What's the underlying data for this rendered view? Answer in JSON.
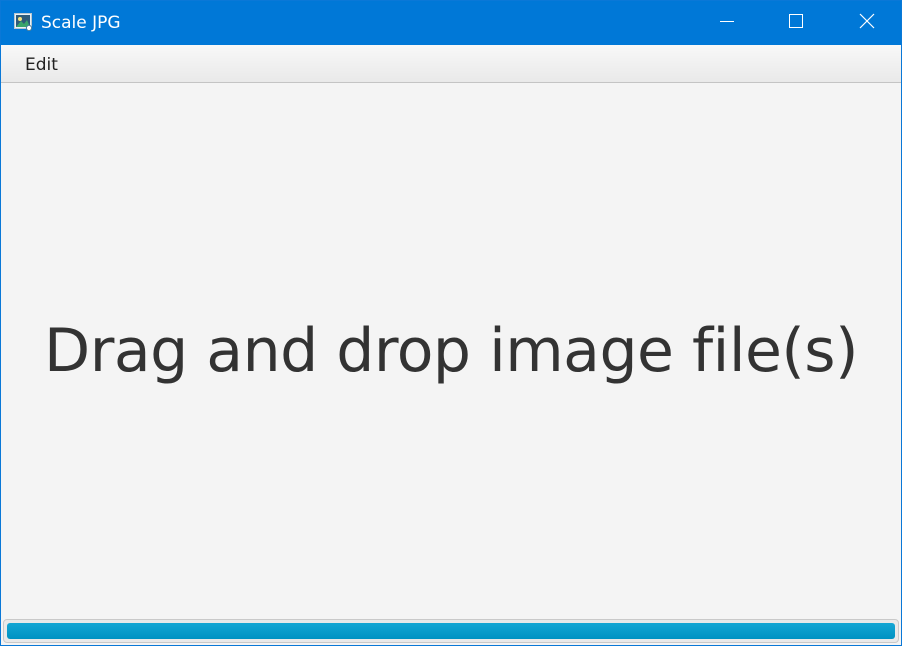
{
  "window": {
    "title": "Scale JPG",
    "app_icon": "image-app-icon",
    "controls": {
      "minimize_icon": "minimize-icon",
      "maximize_icon": "maximize-icon",
      "close_icon": "close-icon"
    },
    "titlebar_color": "#0078d7"
  },
  "menubar": {
    "items": [
      {
        "label": "Edit"
      }
    ]
  },
  "main": {
    "drop_prompt": "Drag and drop image file(s)"
  },
  "progress": {
    "value_fraction": 1.0,
    "fill_color": "#0096c8"
  }
}
